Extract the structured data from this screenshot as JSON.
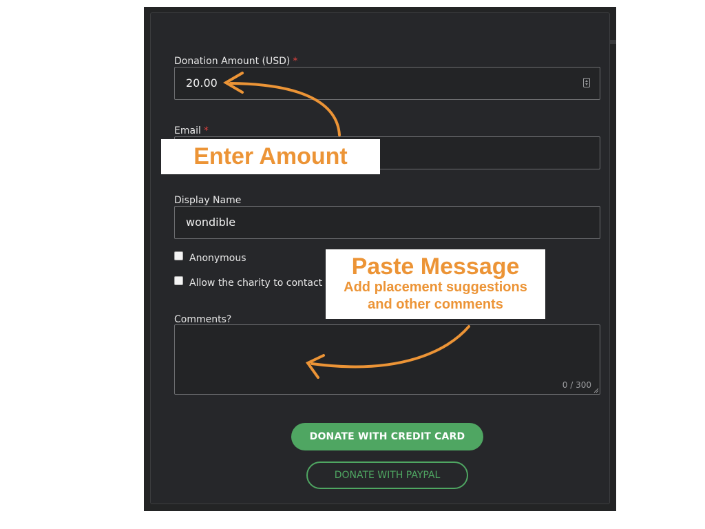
{
  "form": {
    "amount": {
      "label": "Donation Amount (USD)",
      "required_mark": "*",
      "value": "20.00"
    },
    "email": {
      "label": "Email",
      "required_mark": "*",
      "value": ""
    },
    "display_name": {
      "label": "Display Name",
      "value": "wondible"
    },
    "anonymous": {
      "label": "Anonymous",
      "checked": false
    },
    "contact": {
      "label": "Allow the charity to contact you",
      "checked": false
    },
    "comments": {
      "label": "Comments?",
      "value": "",
      "counter": "0 / 300"
    },
    "buttons": {
      "credit_card": "DONATE WITH CREDIT CARD",
      "paypal": "DONATE WITH PAYPAL"
    }
  },
  "annotations": {
    "enter_amount": "Enter Amount",
    "paste_message": "Paste Message",
    "paste_hint_line1": "Add placement suggestions",
    "paste_hint_line2": "and other comments"
  },
  "colors": {
    "accent": "#4fa662",
    "annotation": "#ec9436",
    "required": "#e0413e",
    "background": "#26272a"
  }
}
